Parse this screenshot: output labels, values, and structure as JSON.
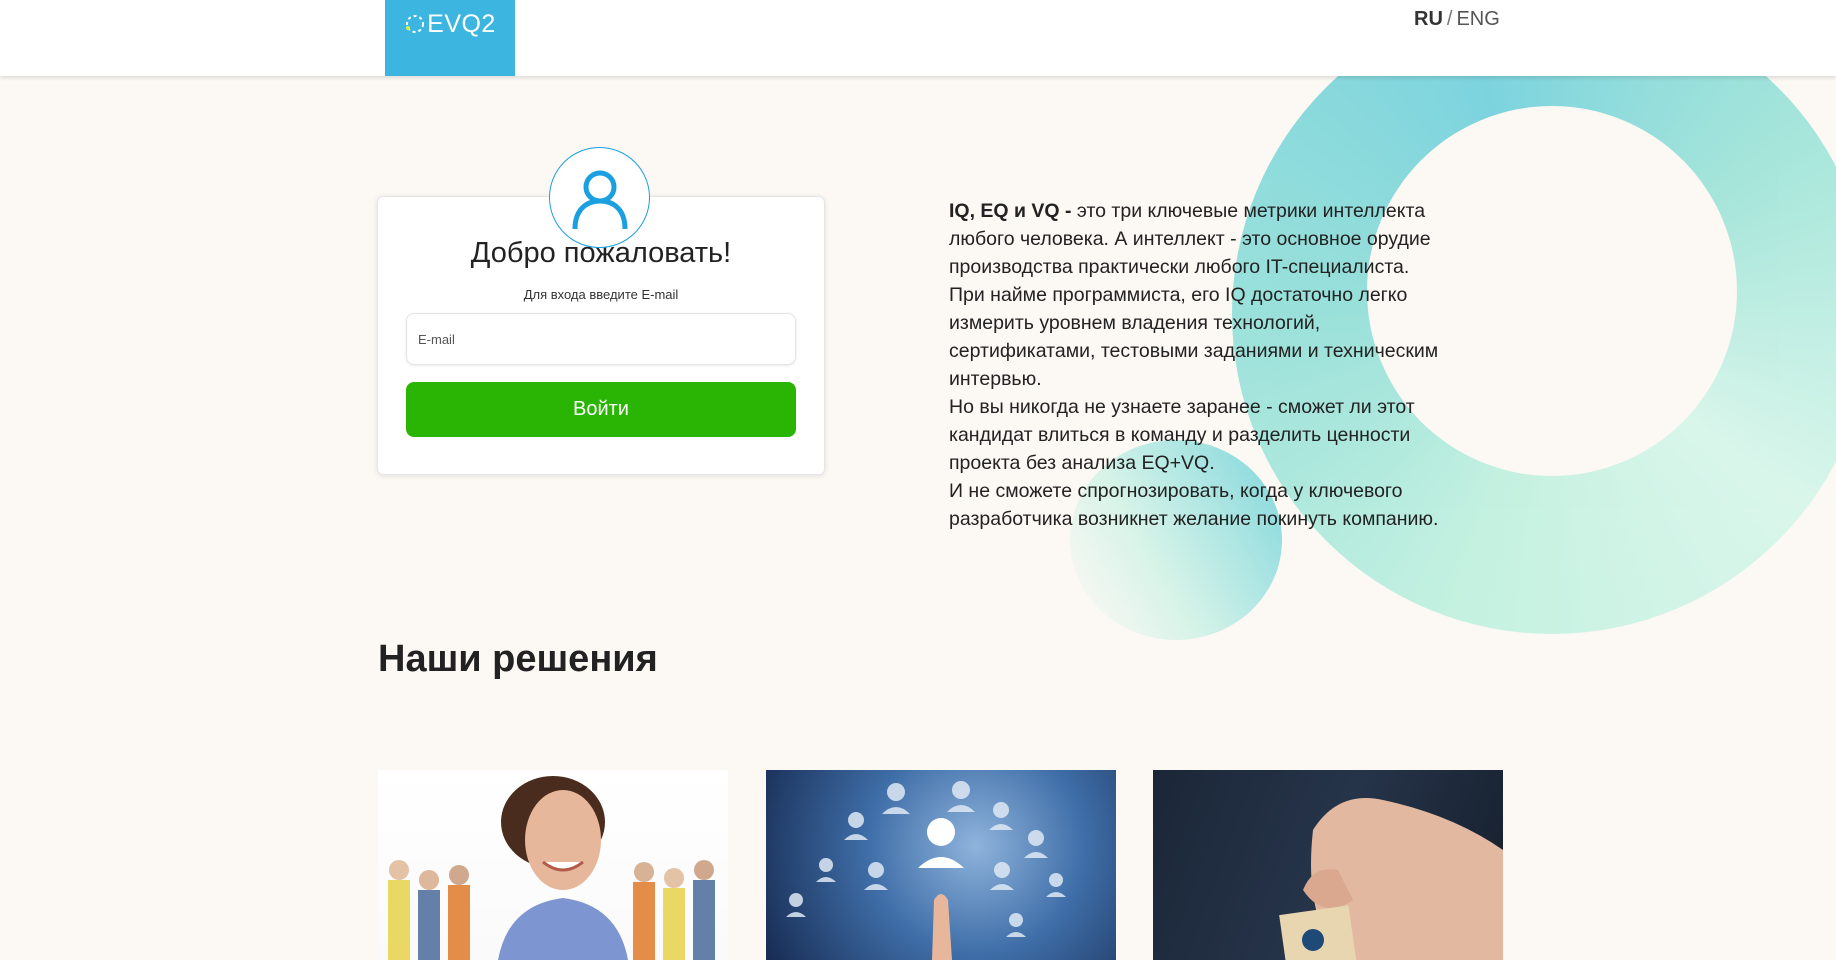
{
  "header": {
    "logo_text": "EVQ2",
    "languages": [
      {
        "label": "RU",
        "active": true
      },
      {
        "label": "ENG",
        "active": false
      }
    ],
    "language_separator": "/"
  },
  "login": {
    "avatar_icon": "user-icon",
    "title": "Добро пожаловать!",
    "subtitle": "Для входа введите E-mail",
    "email_placeholder": "E-mail",
    "email_value": "",
    "submit_label": "Войти"
  },
  "info": {
    "paragraphs": [
      {
        "lead": "IQ, EQ и VQ - ",
        "text": "это три ключевые метрики интеллекта любого человека. А интеллект - это основное орудие производства практически любого IT-специалиста."
      },
      {
        "lead": "",
        "text": "При найме программиста, его IQ достаточно легко измерить уровнем владения технологий, сертификатами, тестовыми заданиями и техническим интервью."
      },
      {
        "lead": "",
        "text": "Но вы никогда не узнаете заранее - сможет ли этот кандидат влиться в команду и разделить ценности проекта без анализа EQ+VQ."
      },
      {
        "lead": "",
        "text": "И не сможете спрогнозировать, когда у ключевого разработчика возникнет желание покинуть компанию."
      }
    ]
  },
  "solutions": {
    "title": "Наши решения",
    "tiles": [
      {
        "image": "smiling-woman-with-workers-photo"
      },
      {
        "image": "touching-network-of-people-photo"
      },
      {
        "image": "hand-holding-cube-photo"
      }
    ]
  },
  "colors": {
    "header_bg": "#ffffff",
    "logo_bg": "#3cb6e0",
    "page_bg": "#fcf8f4",
    "button_green": "#2ab505",
    "avatar_blue": "#1a9fe0",
    "ring_teal": "#7fd6dc"
  }
}
